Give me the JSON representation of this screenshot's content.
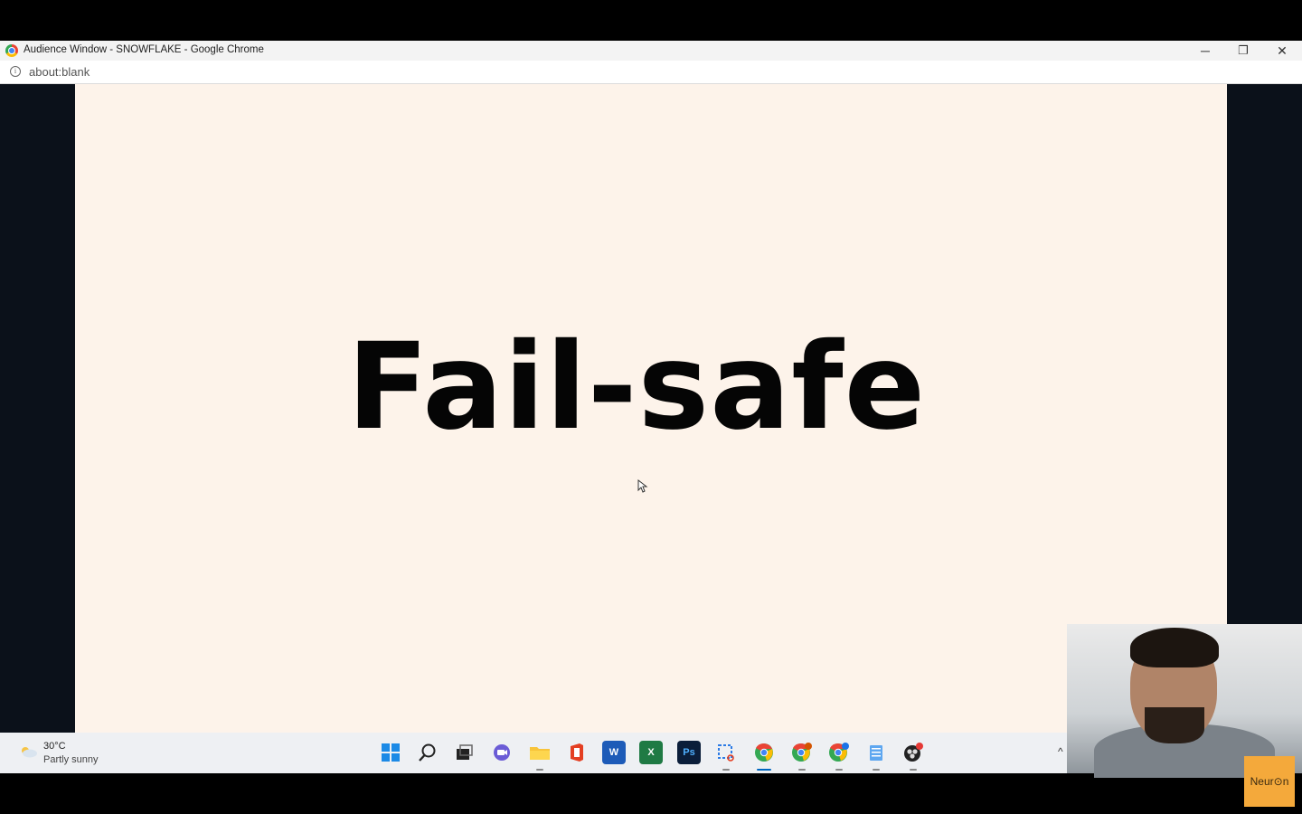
{
  "window": {
    "title": "Audience Window - SNOWFLAKE - Google Chrome",
    "url": "about:blank",
    "minimize_glyph": "─",
    "maximize_glyph": "❐",
    "close_glyph": "✕"
  },
  "slide": {
    "headline": "Fail-safe",
    "background_color": "#fdf3ea"
  },
  "taskbar": {
    "weather": {
      "temperature": "30°C",
      "description": "Partly sunny"
    },
    "apps": [
      {
        "name": "windows-start-icon",
        "label": ""
      },
      {
        "name": "search-icon",
        "label": ""
      },
      {
        "name": "task-view-icon",
        "label": ""
      },
      {
        "name": "teams-chat-icon",
        "label": ""
      },
      {
        "name": "file-explorer-icon",
        "label": ""
      },
      {
        "name": "office-icon",
        "label": ""
      },
      {
        "name": "word-icon",
        "label": "W"
      },
      {
        "name": "excel-icon",
        "label": "X"
      },
      {
        "name": "photoshop-icon",
        "label": "Ps"
      },
      {
        "name": "snipping-tool-icon",
        "label": ""
      },
      {
        "name": "chrome-icon",
        "label": ""
      },
      {
        "name": "chrome-profile-2-icon",
        "label": ""
      },
      {
        "name": "chrome-profile-3-icon",
        "label": ""
      },
      {
        "name": "notepad-icon",
        "label": ""
      },
      {
        "name": "obs-icon",
        "label": ""
      }
    ],
    "tray": {
      "overflow_glyph": "^"
    }
  },
  "overlay": {
    "badge_text": "Neur⊙n"
  }
}
